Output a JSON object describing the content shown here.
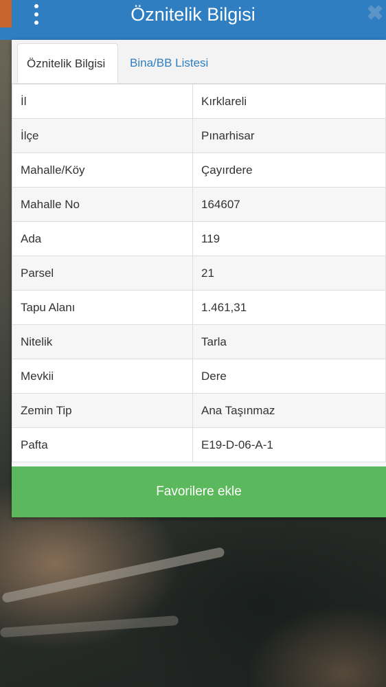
{
  "header": {
    "title": "Öznitelik Bilgisi",
    "close_symbol": "✖",
    "menu_icon": "vertical-dots-icon",
    "close_icon": "close-icon",
    "color": "#2f7ec1"
  },
  "tabs": [
    {
      "label": "Öznitelik Bilgisi",
      "active": true
    },
    {
      "label": "Bina/BB Listesi",
      "active": false
    }
  ],
  "attributes": [
    {
      "key": "İl",
      "value": "Kırklareli"
    },
    {
      "key": "İlçe",
      "value": "Pınarhisar"
    },
    {
      "key": "Mahalle/Köy",
      "value": "Çayırdere"
    },
    {
      "key": "Mahalle No",
      "value": "164607"
    },
    {
      "key": "Ada",
      "value": "119"
    },
    {
      "key": "Parsel",
      "value": "21"
    },
    {
      "key": "Tapu Alanı",
      "value": "1.461,31"
    },
    {
      "key": "Nitelik",
      "value": "Tarla"
    },
    {
      "key": "Mevkii",
      "value": "Dere"
    },
    {
      "key": "Zemin Tip",
      "value": "Ana Taşınmaz"
    },
    {
      "key": "Pafta",
      "value": "E19-D-06-A-1"
    }
  ],
  "favorite_button": {
    "label": "Favorilere ekle",
    "color": "#5cb85c"
  }
}
